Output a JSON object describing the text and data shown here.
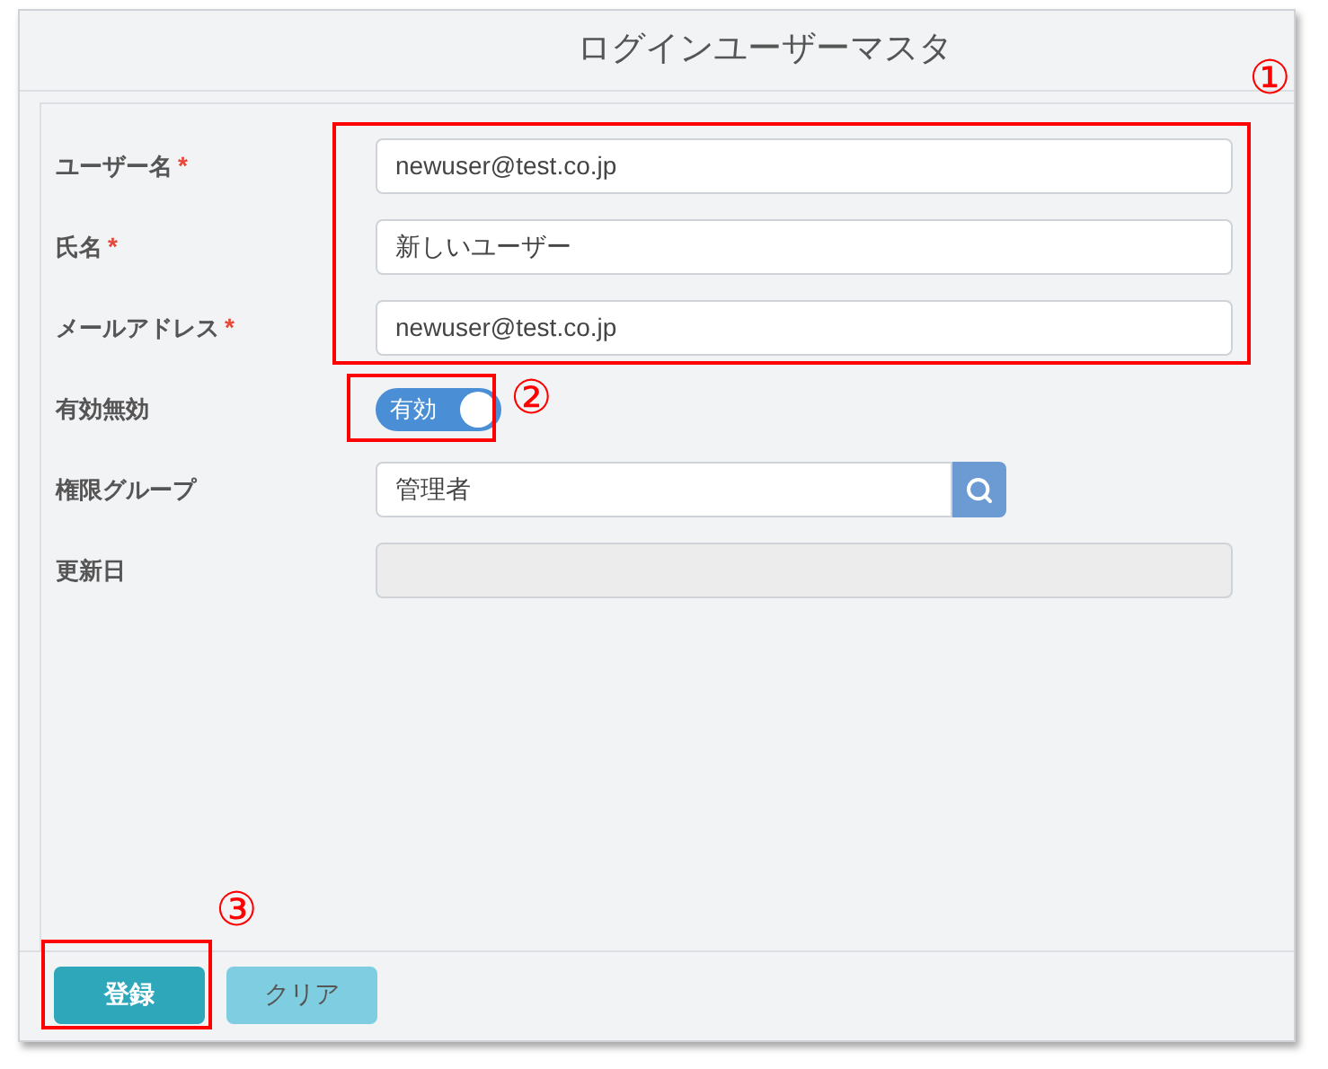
{
  "window": {
    "title": "ログインユーザーマスタ"
  },
  "fields": [
    {
      "kind": "text",
      "label": "ユーザー名",
      "required": true,
      "value": "newuser@test.co.jp"
    },
    {
      "kind": "text",
      "label": "氏名",
      "required": true,
      "value": "新しいユーザー"
    },
    {
      "kind": "text",
      "label": "メールアドレス",
      "required": true,
      "value": "newuser@test.co.jp"
    },
    {
      "kind": "toggle",
      "label": "有効無効",
      "on": true,
      "value": "有効"
    },
    {
      "kind": "lookup",
      "label": "権限グループ",
      "value": "管理者"
    },
    {
      "kind": "readonly",
      "label": "更新日"
    }
  ],
  "required_mark": "*",
  "buttons": [
    {
      "kind": "primary",
      "label": "登録"
    },
    {
      "kind": "secondary",
      "label": "クリア"
    }
  ],
  "annotations": [
    {
      "label": "①"
    },
    {
      "label": "②"
    },
    {
      "label": "③"
    }
  ]
}
